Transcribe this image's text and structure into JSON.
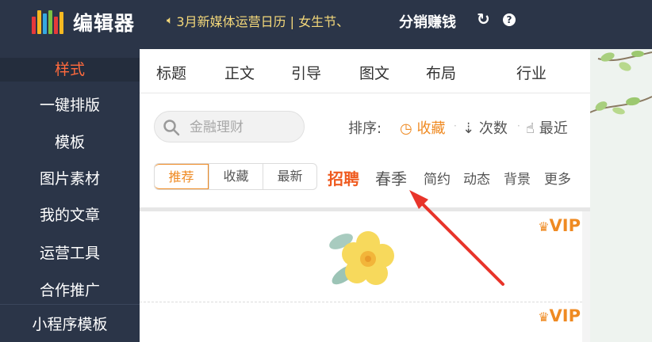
{
  "header": {
    "logo_text": "编辑器",
    "logo_colors": [
      "#e6393b",
      "#f6b921",
      "#36a8e0",
      "#7cc242",
      "#e6393b",
      "#f6b921"
    ],
    "notice": "3月新媒体运营日历 | 女生节、",
    "earn_label": "分销赚钱",
    "refresh_icon": "refresh-icon",
    "help_icon": "help-icon"
  },
  "sidebar": {
    "items": [
      {
        "label": "样式",
        "active": true
      },
      {
        "label": "一键排版"
      },
      {
        "label": "模板"
      },
      {
        "label": "图片素材"
      },
      {
        "label": "我的文章"
      },
      {
        "label": "运营工具"
      },
      {
        "label": "合作推广"
      }
    ],
    "bottom_label": "小程序模板"
  },
  "panel": {
    "categories": [
      "标题",
      "正文",
      "引导",
      "图文",
      "布局",
      "行业"
    ],
    "search": {
      "placeholder": "金融理财"
    },
    "sort": {
      "label": "排序:",
      "options": [
        "收藏",
        "次数",
        "最近"
      ]
    },
    "segments": [
      "推荐",
      "收藏",
      "最新"
    ],
    "tags": [
      "招聘",
      "春季",
      "简约",
      "动态",
      "背景",
      "更多"
    ]
  },
  "list": {
    "vip_label": "VIP"
  },
  "colors": {
    "header_bg": "#2b3548",
    "accent_orange": "#ef8a22",
    "active_red": "#ff6a3d",
    "notice_yellow": "#f5d97a",
    "arrow_red": "#e8342a"
  }
}
